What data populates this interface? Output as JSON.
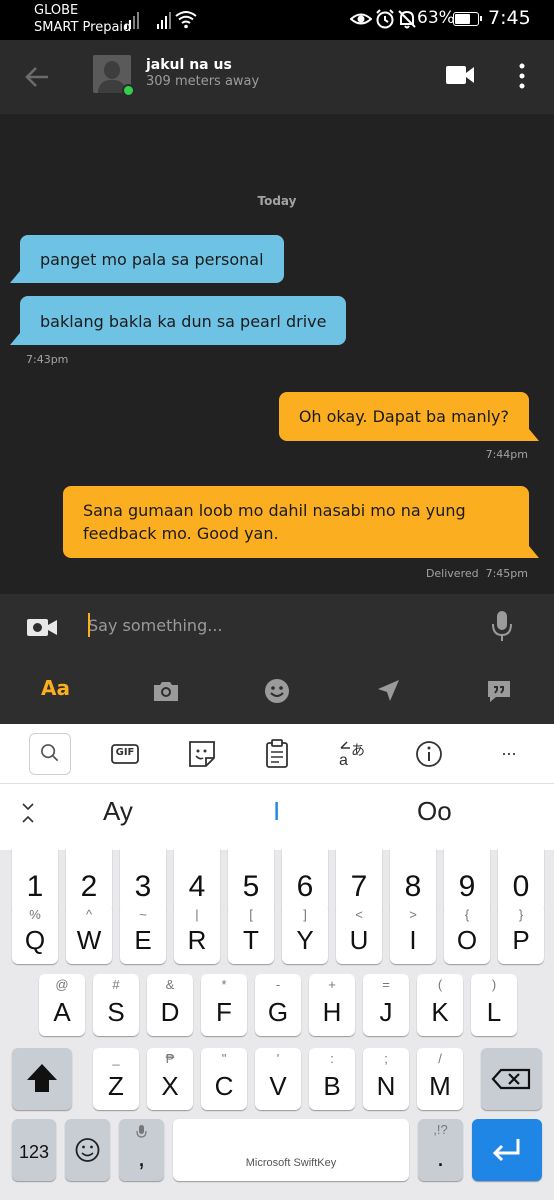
{
  "status_bar": {
    "carrier_1": "GLOBE",
    "carrier_2": "SMART Prepaid",
    "signal_1_label": "4G",
    "signal_2_label": "4G",
    "battery": "63%",
    "battery_level": 0.63,
    "time": "7:45",
    "icons": [
      "eye-icon",
      "alarm-icon",
      "mute-bell-icon",
      "wifi-icon"
    ]
  },
  "header": {
    "contact_name": "jakul na us",
    "distance": "309 meters away",
    "online_color": "#35d04b"
  },
  "chat": {
    "day_label": "Today",
    "messages": [
      {
        "direction": "in",
        "text": "panget mo pala sa personal"
      },
      {
        "direction": "in",
        "text": "baklang bakla ka dun sa pearl drive"
      },
      {
        "direction": "out",
        "text": "Oh okay. Dapat ba manly?"
      },
      {
        "direction": "out",
        "text": "Sana gumaan loob mo dahil nasabi mo na yung feedback mo. Good yan."
      }
    ],
    "timestamps": {
      "in_group": "7:43pm",
      "out_1": "7:44pm",
      "out_2": "Delivered  7:45pm"
    },
    "colors": {
      "incoming": "#6ec3e5",
      "outgoing": "#fbae1f",
      "background": "#222222"
    }
  },
  "input": {
    "placeholder": "Say something..."
  },
  "toolbar": {
    "text_label": "Aa",
    "icons": [
      "camera-icon",
      "sticker-face-icon",
      "location-icon",
      "saved-phrases-icon"
    ]
  },
  "keyboard": {
    "brand": "Microsoft SwiftKey",
    "top_tools": [
      "search-icon",
      "gif-icon",
      "sticker-icon",
      "clipboard-icon",
      "translate-icon",
      "info-icon",
      "more-icon"
    ],
    "gif_label": "GIF",
    "suggestions": [
      "Ay",
      "I",
      "Oo"
    ],
    "more_label": "...",
    "number_row": [
      "1",
      "2",
      "3",
      "4",
      "5",
      "6",
      "7",
      "8",
      "9",
      "0"
    ],
    "row1": [
      {
        "main": "Q",
        "sub": "%"
      },
      {
        "main": "W",
        "sub": "^"
      },
      {
        "main": "E",
        "sub": "~"
      },
      {
        "main": "R",
        "sub": "|"
      },
      {
        "main": "T",
        "sub": "["
      },
      {
        "main": "Y",
        "sub": "]"
      },
      {
        "main": "U",
        "sub": "<"
      },
      {
        "main": "I",
        "sub": ">"
      },
      {
        "main": "O",
        "sub": "{"
      },
      {
        "main": "P",
        "sub": "}"
      }
    ],
    "row2": [
      {
        "main": "A",
        "sub": "@"
      },
      {
        "main": "S",
        "sub": "#"
      },
      {
        "main": "D",
        "sub": "&"
      },
      {
        "main": "F",
        "sub": "*"
      },
      {
        "main": "G",
        "sub": "-"
      },
      {
        "main": "H",
        "sub": "+"
      },
      {
        "main": "J",
        "sub": "="
      },
      {
        "main": "K",
        "sub": "("
      },
      {
        "main": "L",
        "sub": ")"
      }
    ],
    "row3": [
      {
        "main": "Z",
        "sub": "_"
      },
      {
        "main": "X",
        "sub": "₱"
      },
      {
        "main": "C",
        "sub": "\""
      },
      {
        "main": "V",
        "sub": "'"
      },
      {
        "main": "B",
        "sub": ":"
      },
      {
        "main": "N",
        "sub": ";"
      },
      {
        "main": "M",
        "sub": "/"
      }
    ],
    "numbers_key": "123",
    "comma_key": ",",
    "period_key": ".",
    "period_sub": ",!?"
  }
}
